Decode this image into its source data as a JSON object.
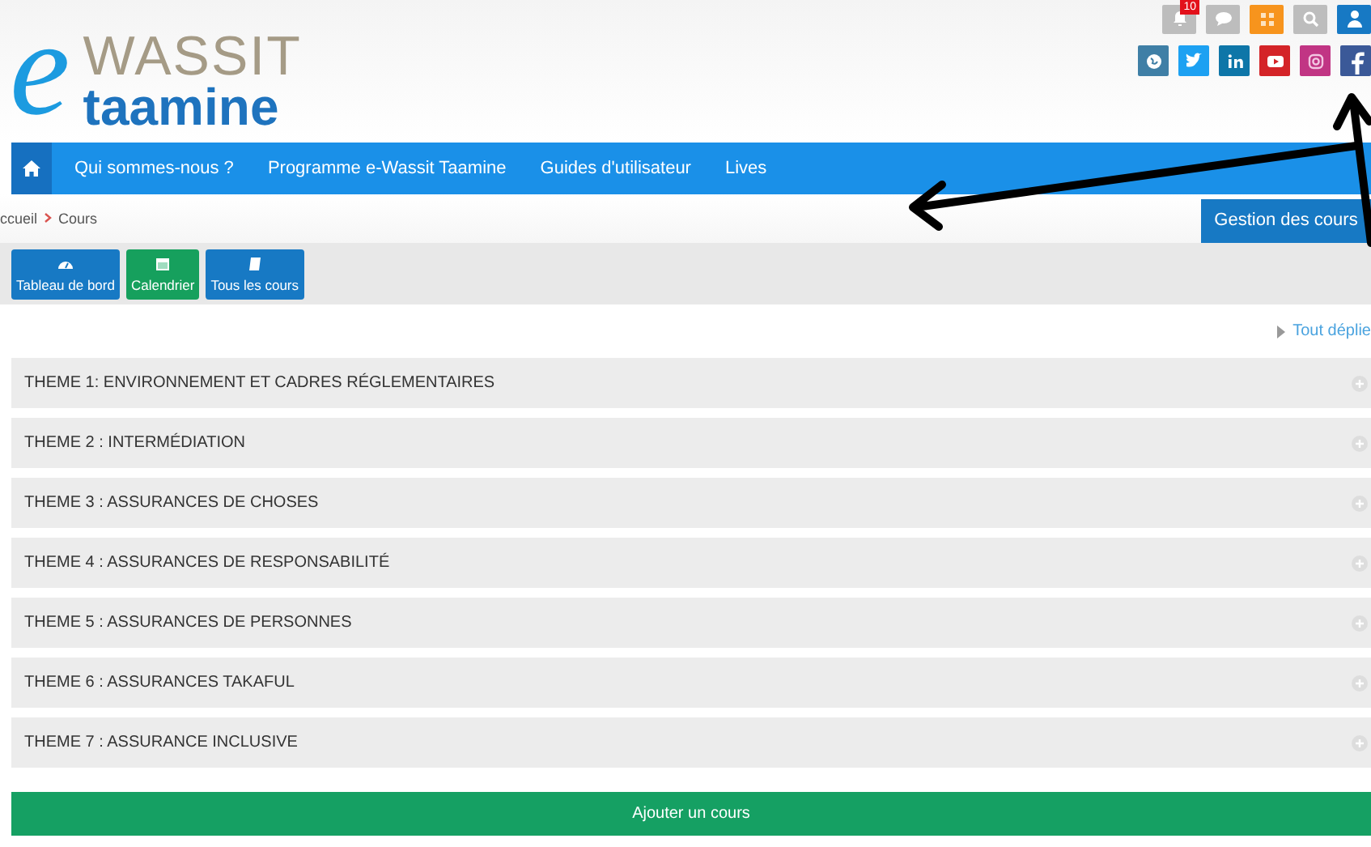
{
  "logo": {
    "letter": "e",
    "word_top": "WASSIT",
    "word_bottom": "taamine"
  },
  "top_icons": [
    {
      "kind": "bell",
      "badge": "10",
      "color": "#bdbdbd"
    },
    {
      "kind": "chat",
      "color": "#bdbdbd"
    },
    {
      "kind": "puzzle",
      "color": "#f7941d"
    },
    {
      "kind": "search",
      "color": "#bdbdbd"
    },
    {
      "kind": "user",
      "color": "#1779c4"
    }
  ],
  "social_icons": [
    {
      "kind": "globe",
      "color": "#3f7fa6"
    },
    {
      "kind": "twitter",
      "color": "#1da1f2"
    },
    {
      "kind": "linkedin",
      "color": "#0e76a8"
    },
    {
      "kind": "youtube",
      "color": "#d42428"
    },
    {
      "kind": "instagram",
      "color": "#c13584"
    },
    {
      "kind": "facebook",
      "color": "#3b5998"
    }
  ],
  "nav": {
    "items": [
      {
        "label": "Qui sommes-nous ?"
      },
      {
        "label": "Programme e-Wassit Taamine"
      },
      {
        "label": "Guides d'utilisateur"
      },
      {
        "label": "Lives"
      }
    ]
  },
  "breadcrumb": [
    "ccueil",
    "Cours"
  ],
  "manage_button": "Gestion des cours",
  "toolbar": [
    {
      "label": "Tableau de bord",
      "kind": "dashboard",
      "color": "#1779c4"
    },
    {
      "label": "Calendrier",
      "kind": "calendar",
      "color": "#16a05d"
    },
    {
      "label": "Tous les cours",
      "kind": "book",
      "color": "#1779c4"
    }
  ],
  "expand_all": "Tout déplie",
  "themes": [
    {
      "title": "THEME 1: ENVIRONNEMENT ET CADRES RÉGLEMENTAIRES",
      "expanded": false
    },
    {
      "title": "THEME 2 : INTERMÉDIATION",
      "expanded": false
    },
    {
      "title": "THEME 3 : ASSURANCES DE CHOSES",
      "expanded": false
    },
    {
      "title": "THEME 4 : ASSURANCES DE RESPONSABILITÉ",
      "expanded": false
    },
    {
      "title": "THEME 5 : ASSURANCES DE PERSONNES",
      "expanded": false
    },
    {
      "title": "THEME 6 : ASSURANCES TAKAFUL",
      "expanded": false
    },
    {
      "title": "THEME 7 : ASSURANCE INCLUSIVE",
      "expanded": false
    }
  ],
  "add_button": "Ajouter un cours"
}
